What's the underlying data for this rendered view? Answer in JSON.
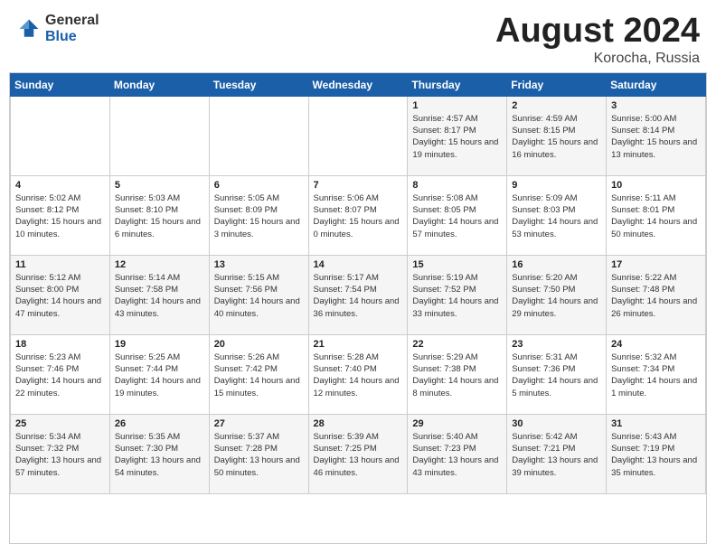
{
  "header": {
    "logo_general": "General",
    "logo_blue": "Blue",
    "title": "August 2024",
    "location": "Korocha, Russia"
  },
  "weekdays": [
    "Sunday",
    "Monday",
    "Tuesday",
    "Wednesday",
    "Thursday",
    "Friday",
    "Saturday"
  ],
  "weeks": [
    [
      {
        "day": "",
        "sunrise": "",
        "sunset": "",
        "daylight": ""
      },
      {
        "day": "",
        "sunrise": "",
        "sunset": "",
        "daylight": ""
      },
      {
        "day": "",
        "sunrise": "",
        "sunset": "",
        "daylight": ""
      },
      {
        "day": "",
        "sunrise": "",
        "sunset": "",
        "daylight": ""
      },
      {
        "day": "1",
        "sunrise": "Sunrise: 4:57 AM",
        "sunset": "Sunset: 8:17 PM",
        "daylight": "Daylight: 15 hours and 19 minutes."
      },
      {
        "day": "2",
        "sunrise": "Sunrise: 4:59 AM",
        "sunset": "Sunset: 8:15 PM",
        "daylight": "Daylight: 15 hours and 16 minutes."
      },
      {
        "day": "3",
        "sunrise": "Sunrise: 5:00 AM",
        "sunset": "Sunset: 8:14 PM",
        "daylight": "Daylight: 15 hours and 13 minutes."
      }
    ],
    [
      {
        "day": "4",
        "sunrise": "Sunrise: 5:02 AM",
        "sunset": "Sunset: 8:12 PM",
        "daylight": "Daylight: 15 hours and 10 minutes."
      },
      {
        "day": "5",
        "sunrise": "Sunrise: 5:03 AM",
        "sunset": "Sunset: 8:10 PM",
        "daylight": "Daylight: 15 hours and 6 minutes."
      },
      {
        "day": "6",
        "sunrise": "Sunrise: 5:05 AM",
        "sunset": "Sunset: 8:09 PM",
        "daylight": "Daylight: 15 hours and 3 minutes."
      },
      {
        "day": "7",
        "sunrise": "Sunrise: 5:06 AM",
        "sunset": "Sunset: 8:07 PM",
        "daylight": "Daylight: 15 hours and 0 minutes."
      },
      {
        "day": "8",
        "sunrise": "Sunrise: 5:08 AM",
        "sunset": "Sunset: 8:05 PM",
        "daylight": "Daylight: 14 hours and 57 minutes."
      },
      {
        "day": "9",
        "sunrise": "Sunrise: 5:09 AM",
        "sunset": "Sunset: 8:03 PM",
        "daylight": "Daylight: 14 hours and 53 minutes."
      },
      {
        "day": "10",
        "sunrise": "Sunrise: 5:11 AM",
        "sunset": "Sunset: 8:01 PM",
        "daylight": "Daylight: 14 hours and 50 minutes."
      }
    ],
    [
      {
        "day": "11",
        "sunrise": "Sunrise: 5:12 AM",
        "sunset": "Sunset: 8:00 PM",
        "daylight": "Daylight: 14 hours and 47 minutes."
      },
      {
        "day": "12",
        "sunrise": "Sunrise: 5:14 AM",
        "sunset": "Sunset: 7:58 PM",
        "daylight": "Daylight: 14 hours and 43 minutes."
      },
      {
        "day": "13",
        "sunrise": "Sunrise: 5:15 AM",
        "sunset": "Sunset: 7:56 PM",
        "daylight": "Daylight: 14 hours and 40 minutes."
      },
      {
        "day": "14",
        "sunrise": "Sunrise: 5:17 AM",
        "sunset": "Sunset: 7:54 PM",
        "daylight": "Daylight: 14 hours and 36 minutes."
      },
      {
        "day": "15",
        "sunrise": "Sunrise: 5:19 AM",
        "sunset": "Sunset: 7:52 PM",
        "daylight": "Daylight: 14 hours and 33 minutes."
      },
      {
        "day": "16",
        "sunrise": "Sunrise: 5:20 AM",
        "sunset": "Sunset: 7:50 PM",
        "daylight": "Daylight: 14 hours and 29 minutes."
      },
      {
        "day": "17",
        "sunrise": "Sunrise: 5:22 AM",
        "sunset": "Sunset: 7:48 PM",
        "daylight": "Daylight: 14 hours and 26 minutes."
      }
    ],
    [
      {
        "day": "18",
        "sunrise": "Sunrise: 5:23 AM",
        "sunset": "Sunset: 7:46 PM",
        "daylight": "Daylight: 14 hours and 22 minutes."
      },
      {
        "day": "19",
        "sunrise": "Sunrise: 5:25 AM",
        "sunset": "Sunset: 7:44 PM",
        "daylight": "Daylight: 14 hours and 19 minutes."
      },
      {
        "day": "20",
        "sunrise": "Sunrise: 5:26 AM",
        "sunset": "Sunset: 7:42 PM",
        "daylight": "Daylight: 14 hours and 15 minutes."
      },
      {
        "day": "21",
        "sunrise": "Sunrise: 5:28 AM",
        "sunset": "Sunset: 7:40 PM",
        "daylight": "Daylight: 14 hours and 12 minutes."
      },
      {
        "day": "22",
        "sunrise": "Sunrise: 5:29 AM",
        "sunset": "Sunset: 7:38 PM",
        "daylight": "Daylight: 14 hours and 8 minutes."
      },
      {
        "day": "23",
        "sunrise": "Sunrise: 5:31 AM",
        "sunset": "Sunset: 7:36 PM",
        "daylight": "Daylight: 14 hours and 5 minutes."
      },
      {
        "day": "24",
        "sunrise": "Sunrise: 5:32 AM",
        "sunset": "Sunset: 7:34 PM",
        "daylight": "Daylight: 14 hours and 1 minute."
      }
    ],
    [
      {
        "day": "25",
        "sunrise": "Sunrise: 5:34 AM",
        "sunset": "Sunset: 7:32 PM",
        "daylight": "Daylight: 13 hours and 57 minutes."
      },
      {
        "day": "26",
        "sunrise": "Sunrise: 5:35 AM",
        "sunset": "Sunset: 7:30 PM",
        "daylight": "Daylight: 13 hours and 54 minutes."
      },
      {
        "day": "27",
        "sunrise": "Sunrise: 5:37 AM",
        "sunset": "Sunset: 7:28 PM",
        "daylight": "Daylight: 13 hours and 50 minutes."
      },
      {
        "day": "28",
        "sunrise": "Sunrise: 5:39 AM",
        "sunset": "Sunset: 7:25 PM",
        "daylight": "Daylight: 13 hours and 46 minutes."
      },
      {
        "day": "29",
        "sunrise": "Sunrise: 5:40 AM",
        "sunset": "Sunset: 7:23 PM",
        "daylight": "Daylight: 13 hours and 43 minutes."
      },
      {
        "day": "30",
        "sunrise": "Sunrise: 5:42 AM",
        "sunset": "Sunset: 7:21 PM",
        "daylight": "Daylight: 13 hours and 39 minutes."
      },
      {
        "day": "31",
        "sunrise": "Sunrise: 5:43 AM",
        "sunset": "Sunset: 7:19 PM",
        "daylight": "Daylight: 13 hours and 35 minutes."
      }
    ]
  ]
}
